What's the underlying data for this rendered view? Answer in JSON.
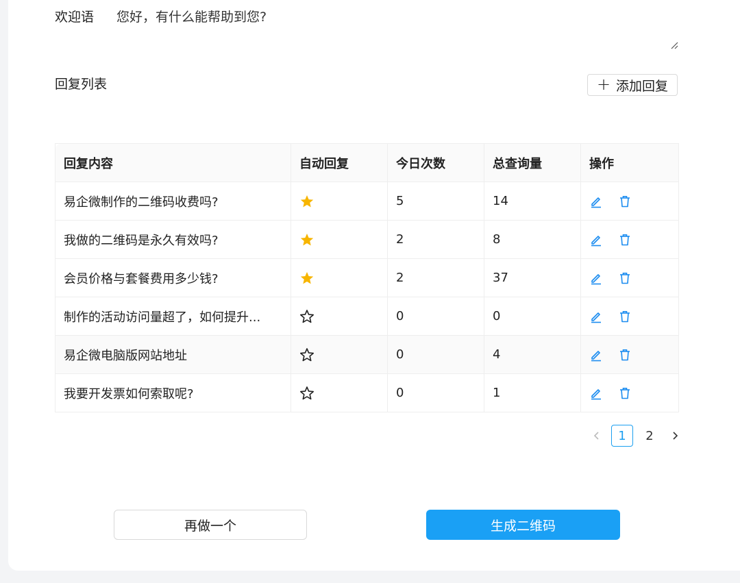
{
  "welcome": {
    "label": "欢迎语",
    "text": "您好，有什么能帮助到您?"
  },
  "reply_list": {
    "title": "回复列表",
    "add_button": "添加回复"
  },
  "table": {
    "headers": [
      "回复内容",
      "自动回复",
      "今日次数",
      "总查询量",
      "操作"
    ],
    "rows": [
      {
        "content": "易企微制作的二维码收费吗?",
        "auto_reply": true,
        "today": "5",
        "total": "14"
      },
      {
        "content": "我做的二维码是永久有效吗?",
        "auto_reply": true,
        "today": "2",
        "total": "8"
      },
      {
        "content": "会员价格与套餐费用多少钱?",
        "auto_reply": true,
        "today": "2",
        "total": "37"
      },
      {
        "content": "制作的活动访问量超了，如何提升...",
        "auto_reply": false,
        "today": "0",
        "total": "0"
      },
      {
        "content": "易企微电脑版网站地址",
        "auto_reply": false,
        "today": "0",
        "total": "4"
      },
      {
        "content": "我要开发票如何索取呢?",
        "auto_reply": false,
        "today": "0",
        "total": "1"
      }
    ]
  },
  "pagination": {
    "pages": [
      "1",
      "2"
    ],
    "current": "1"
  },
  "actions": {
    "redo_label": "再做一个",
    "generate_label": "生成二维码"
  },
  "colors": {
    "accent": "#1aa0f5",
    "star_filled": "#f7b500",
    "icon_blue": "#1b8cf0"
  }
}
